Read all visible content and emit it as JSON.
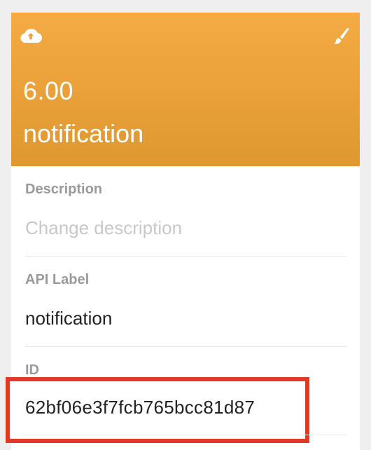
{
  "header": {
    "upload_icon": "cloud-upload-icon",
    "brush_icon": "paint-brush-icon",
    "value": "6.00",
    "name": "notification",
    "colors": {
      "header_top": "#f4ab43",
      "header_bottom": "#df972f",
      "highlight": "#e03a24"
    }
  },
  "fields": {
    "description": {
      "label": "Description",
      "placeholder": "Change description"
    },
    "api_label": {
      "label": "API Label",
      "value": "notification"
    },
    "id": {
      "label": "ID",
      "value": "62bf06e3f7fcb765bcc81d87"
    }
  }
}
